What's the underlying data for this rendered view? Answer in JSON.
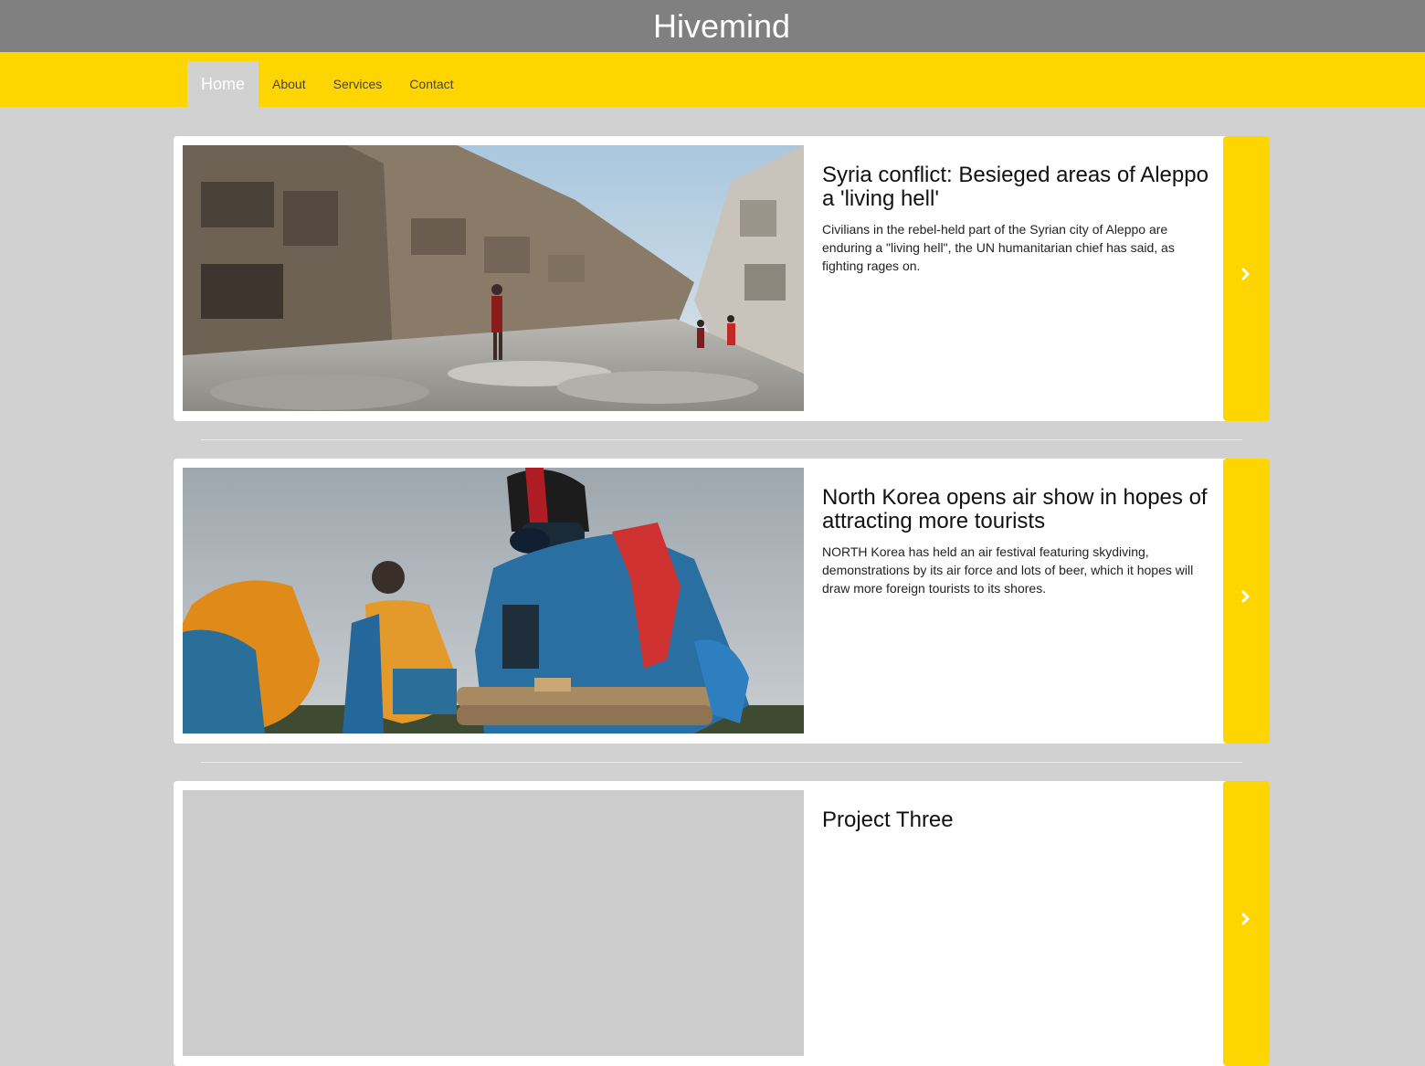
{
  "site": {
    "brand": "Hivemind"
  },
  "nav": {
    "items": [
      {
        "label": "Home",
        "active": true
      },
      {
        "label": "About",
        "active": false
      },
      {
        "label": "Services",
        "active": false
      },
      {
        "label": "Contact",
        "active": false
      }
    ]
  },
  "cards": [
    {
      "title": "Syria conflict: Besieged areas of Aleppo a 'living hell'",
      "description": "Civilians in the rebel-held part of the Syrian city of Aleppo are enduring a \"living hell\", the UN humanitarian chief has said, as fighting rages on.",
      "image": "war-damaged-street-photo",
      "action_icon": "chevron-right-icon"
    },
    {
      "title": "North Korea opens air show in hopes of attracting more tourists",
      "description": "NORTH Korea has held an air festival featuring skydiving, demonstrations by its air force and lots of beer, which it hopes will draw more foreign tourists to its shores.",
      "image": "skydivers-photo",
      "action_icon": "chevron-right-icon"
    },
    {
      "title": "Project Three",
      "description": "",
      "image": "placeholder-image",
      "action_icon": "chevron-right-icon"
    }
  ],
  "colors": {
    "header_bg": "#808080",
    "accent": "#ffd500",
    "page_bg": "#d2d1d2"
  }
}
